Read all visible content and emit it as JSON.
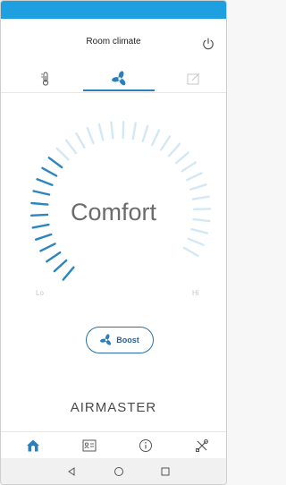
{
  "app": {
    "title": "Room climate",
    "brand": "AIRMASTER"
  },
  "colors": {
    "status_bar": "#1ea0e0",
    "accent": "#2a7fbf",
    "dial_active": "#2b86c0",
    "dial_inactive": "#d3e8f4"
  },
  "tabs": [
    {
      "icon": "thermometer-icon",
      "active": false
    },
    {
      "icon": "fan-icon",
      "active": true
    },
    {
      "icon": "edit-icon",
      "active": false
    }
  ],
  "dial": {
    "mode": "Comfort",
    "lo_label": "Lo",
    "hi_label": "Hi",
    "level_fraction": 0.35
  },
  "boost": {
    "label": "Boost",
    "icon": "fan-icon"
  },
  "bottom_nav": [
    {
      "icon": "home-icon",
      "active": true
    },
    {
      "icon": "id-card-icon",
      "active": false
    },
    {
      "icon": "info-icon",
      "active": false
    },
    {
      "icon": "tools-icon",
      "active": false
    }
  ],
  "system_nav": [
    {
      "icon": "back-icon"
    },
    {
      "icon": "home-circle-icon"
    },
    {
      "icon": "recents-icon"
    }
  ]
}
